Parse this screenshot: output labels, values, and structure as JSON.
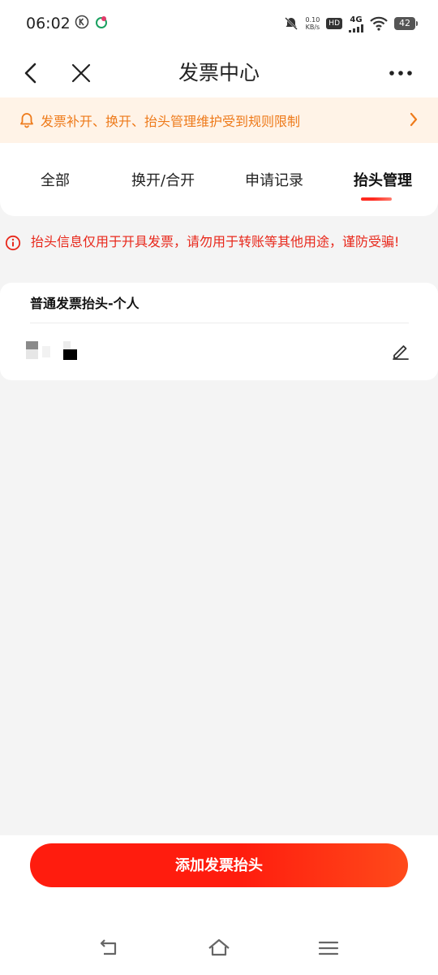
{
  "status": {
    "time": "06:02",
    "net_speed_value": "0.10",
    "net_speed_unit": "KB/s",
    "hd_label": "HD",
    "network": "4G",
    "battery": "42"
  },
  "nav": {
    "title": "发票中心"
  },
  "notice": {
    "text": "发票补开、换开、抬头管理维护受到规则限制"
  },
  "tabs": [
    {
      "label": "全部",
      "active": false
    },
    {
      "label": "换开/合开",
      "active": false
    },
    {
      "label": "申请记录",
      "active": false
    },
    {
      "label": "抬头管理",
      "active": true
    }
  ],
  "warning": {
    "text": "抬头信息仅用于开具发票，请勿用于转账等其他用途，谨防受骗!"
  },
  "invoice_header": {
    "type_label": "普通发票抬头-个人"
  },
  "actions": {
    "add_header_label": "添加发票抬头"
  },
  "colors": {
    "accent": "#ff1c0e",
    "notice_text": "#ee7a1a",
    "notice_bg": "#fff3e7",
    "warning_text": "#e8281b"
  },
  "icons": {
    "back": "chevron-left-icon",
    "close": "close-icon",
    "more": "more-icon",
    "bell": "bell-icon",
    "notice_arrow": "chevron-right-icon",
    "warning": "info-circle-icon",
    "edit": "edit-icon",
    "nav_back": "system-back-icon",
    "nav_home": "system-home-icon",
    "nav_menu": "system-menu-icon"
  }
}
